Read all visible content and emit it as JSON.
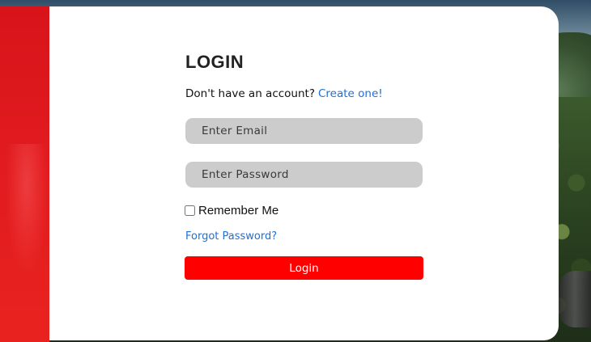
{
  "theme": {
    "accent": "#ff0000",
    "link": "#1f6fd6",
    "input_bg": "#cccccc",
    "panel_red": "#e01a1f"
  },
  "login": {
    "title": "LOGIN",
    "signup_prompt": "Don't have an account?",
    "signup_link": "Create one!",
    "email_placeholder": "Enter Email",
    "password_placeholder": "Enter Password",
    "remember_label": "Remember Me",
    "remember_checked": false,
    "forgot_link": "Forgot Password?",
    "submit_label": "Login"
  }
}
